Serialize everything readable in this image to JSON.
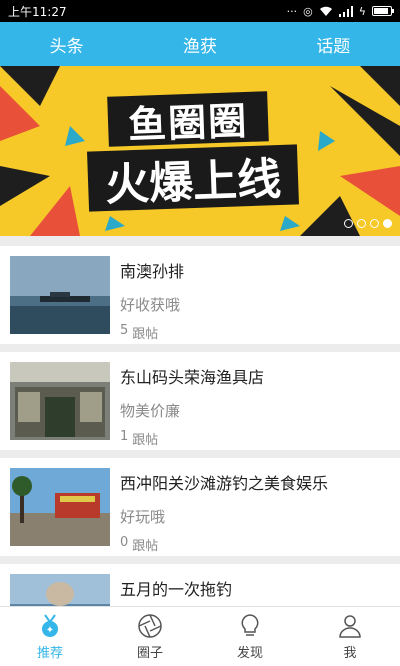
{
  "status_bar": {
    "time": "上午11:27",
    "icons": [
      "dots-icon",
      "sync-icon",
      "wifi-icon",
      "signal-icon",
      "charging-icon",
      "battery-icon"
    ]
  },
  "top_tabs": [
    {
      "label": "头条"
    },
    {
      "label": "渔获"
    },
    {
      "label": "话题"
    }
  ],
  "banner": {
    "line1": "鱼圈圈",
    "line2": "火爆上线",
    "pager_total": 4,
    "pager_active": 4
  },
  "feed": [
    {
      "title": "南澳孙排",
      "subtitle": "好收获哦",
      "count": "5",
      "count_label": "跟帖"
    },
    {
      "title": "东山码头荣海渔具店",
      "subtitle": "物美价廉",
      "count": "1",
      "count_label": "跟帖"
    },
    {
      "title": "西冲阳关沙滩游钓之美食娱乐",
      "subtitle": "好玩哦",
      "count": "0",
      "count_label": "跟帖"
    },
    {
      "title": "五月的一次拖钓",
      "subtitle": "",
      "count": "",
      "count_label": ""
    }
  ],
  "bottom_nav": [
    {
      "label": "推荐",
      "icon": "medal-icon",
      "active": true
    },
    {
      "label": "圈子",
      "icon": "aperture-icon",
      "active": false
    },
    {
      "label": "发现",
      "icon": "lightbulb-icon",
      "active": false
    },
    {
      "label": "我",
      "icon": "person-icon",
      "active": false
    }
  ],
  "colors": {
    "accent": "#34b6e8",
    "banner_yellow": "#f6c928",
    "text_muted": "#8a8a8a"
  }
}
